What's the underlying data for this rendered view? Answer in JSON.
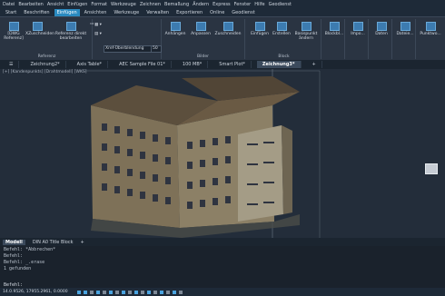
{
  "menubar": {
    "items": [
      "Datei",
      "Bearbeiten",
      "Ansicht",
      "Einfügen",
      "Format",
      "Werkzeuge",
      "Zeichnen",
      "Bemaßung",
      "Ändern",
      "Express",
      "Fenster",
      "Hilfe",
      "Geodienst"
    ]
  },
  "ribbon_tabs": {
    "items": [
      "Start",
      "Beschriften",
      "Einfügen",
      "Ansichten",
      "Werkzeuge",
      "Verwalten",
      "Exportieren",
      "Online",
      "Geodienst"
    ],
    "active_index": 2
  },
  "ribbon": {
    "referenz": {
      "title": "Referenz",
      "dwg_label": "[DWG Referenz]",
      "clip_label": "XZuschneiden",
      "link_label": "Referenz direkt bearbeiten",
      "xref_fade_label": "Xref-Überblendung",
      "xref_fade_value": "50"
    },
    "bilder": {
      "title": "Bilder",
      "items": [
        "Anhängen",
        "Anpassen",
        "Zuschneiden"
      ]
    },
    "block": {
      "title": "Block",
      "items": [
        "Einfügen",
        "Erstellen",
        "Basispunkt ändern"
      ]
    },
    "extra": {
      "items": [
        "Blockbl...",
        "Impo...",
        "Daten",
        "Dateie...",
        "Punktwo..."
      ]
    }
  },
  "doc_tabs": {
    "items": [
      "Zeichnung2*",
      "Axis Table*",
      "AEC Sample File 01*",
      "100 MB*",
      "Smart Plot*",
      "Zeichnung3*"
    ],
    "active_index": 5,
    "add_label": "+"
  },
  "viewport": {
    "label": "[+] [Kandenpunkts] [Drahtmodell] [WKS]"
  },
  "layout_tabs": {
    "items": [
      "Modell",
      "DIN A0 Title Block"
    ],
    "active_index": 0,
    "add_label": "+"
  },
  "command_history": [
    "Befehl: *Abbrechen*",
    "Befehl:",
    "Befehl: _.erase",
    "1 gefunden"
  ],
  "command_prompt": "Befehl:",
  "status": {
    "coords": "14.0.9526, 17955.2961, 0.0000"
  },
  "colors": {
    "accent": "#2a8ac0",
    "background": "#232d3a"
  }
}
